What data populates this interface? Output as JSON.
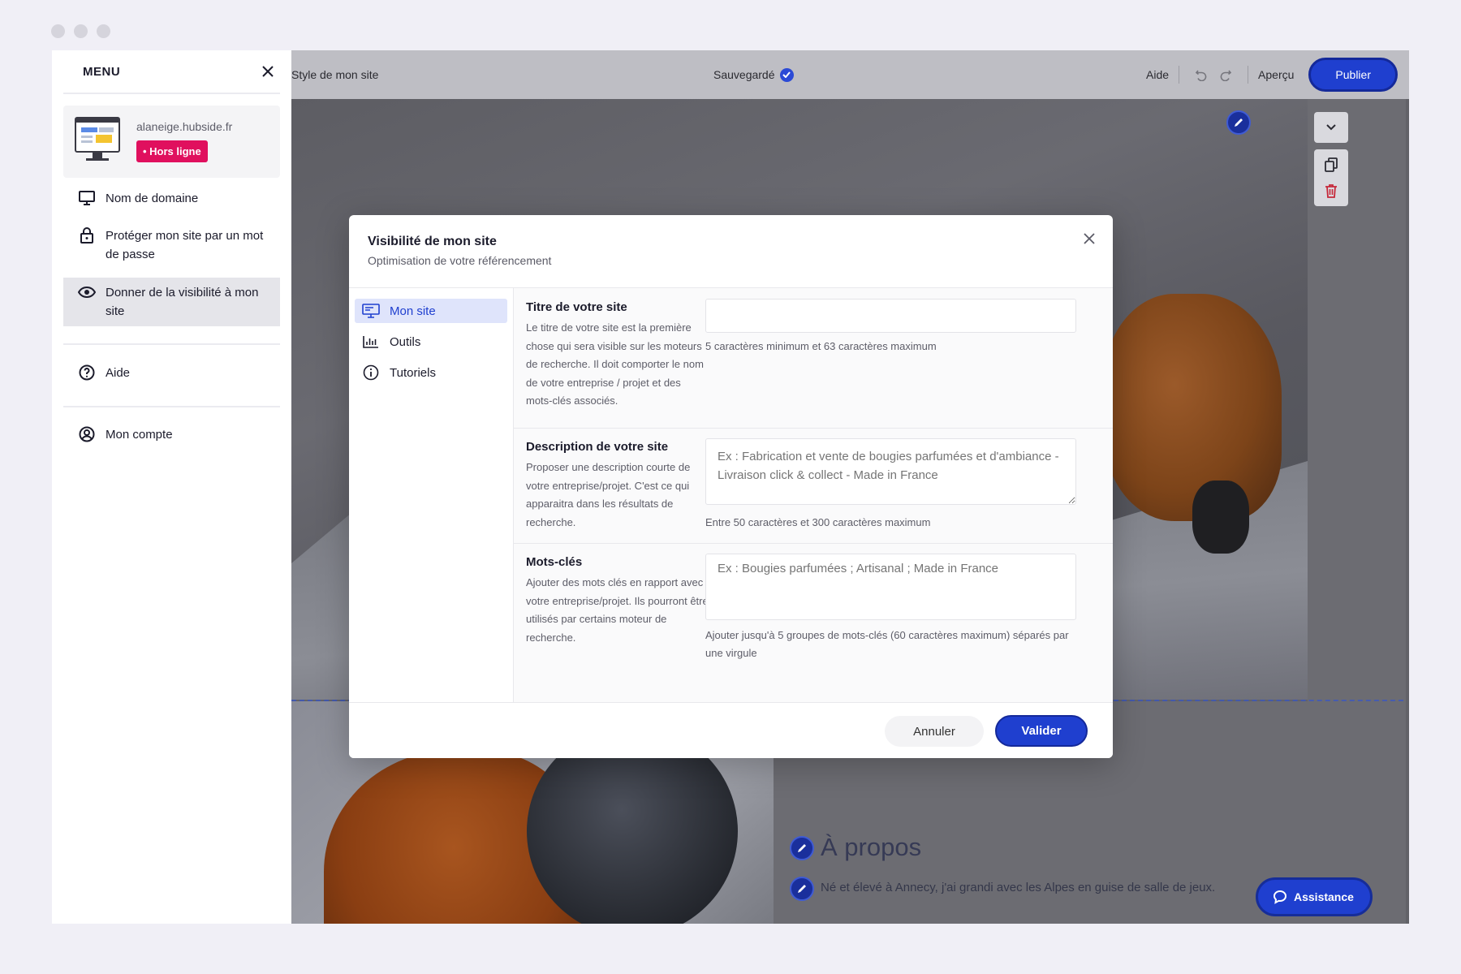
{
  "menu": {
    "title": "MENU",
    "site": {
      "domain": "alaneige.hubside.fr",
      "status": "• Hors ligne"
    },
    "items": [
      {
        "label": "Nom de domaine",
        "icon": "monitor-icon"
      },
      {
        "label": "Protéger mon site par un mot de passe",
        "icon": "lock-icon"
      },
      {
        "label": "Donner de la visibilité à mon site",
        "icon": "eye-icon"
      },
      {
        "label": "Aide",
        "icon": "help-icon"
      },
      {
        "label": "Mon compte",
        "icon": "account-icon"
      }
    ]
  },
  "topbar": {
    "left": "Style de mon site",
    "status": "Sauvegardé",
    "help": "Aide",
    "preview": "Aperçu",
    "publish": "Publier"
  },
  "modal": {
    "title": "Visibilité de mon site",
    "subtitle": "Optimisation de votre référencement",
    "nav": [
      {
        "label": "Mon site",
        "icon": "monitor-icon"
      },
      {
        "label": "Outils",
        "icon": "bar-chart-icon"
      },
      {
        "label": "Tutoriels",
        "icon": "info-icon"
      }
    ],
    "fields": {
      "title": {
        "label": "Titre de votre site",
        "desc": "Le titre de votre site est la première chose qui sera visible sur les moteurs de recherche. Il doit comporter le nom de votre entreprise / projet et des mots-clés associés.",
        "value": "",
        "hint": "5 caractères minimum et 63 caractères maximum"
      },
      "description": {
        "label": "Description de votre site",
        "desc": "Proposer une description courte de votre entreprise/projet. C'est ce qui apparaitra dans les résultats de recherche.",
        "placeholder": "Ex : Fabrication et vente de bougies parfumées et d'ambiance - Livraison click & collect - Made in France",
        "hint": "Entre 50 caractères et 300 caractères maximum"
      },
      "keywords": {
        "label": "Mots-clés",
        "desc": "Ajouter des mots clés en rapport avec votre entreprise/projet. Ils pourront être utilisés par certains moteur de recherche.",
        "placeholder": "Ex : Bougies parfumées ; Artisanal ; Made in France",
        "hint": "Ajouter jusqu'à 5 groupes de mots-clés (60 caractères maximum) séparés par une virgule"
      }
    },
    "cancel": "Annuler",
    "confirm": "Valider"
  },
  "page": {
    "about_title": "À propos",
    "about_text": "Né et élevé à Annecy, j'ai grandi avec les Alpes en guise de salle de jeux."
  },
  "assistance": "Assistance",
  "colors": {
    "accent": "#1f3fcf",
    "offline_badge": "#e0105e",
    "delete": "#c6283a"
  }
}
